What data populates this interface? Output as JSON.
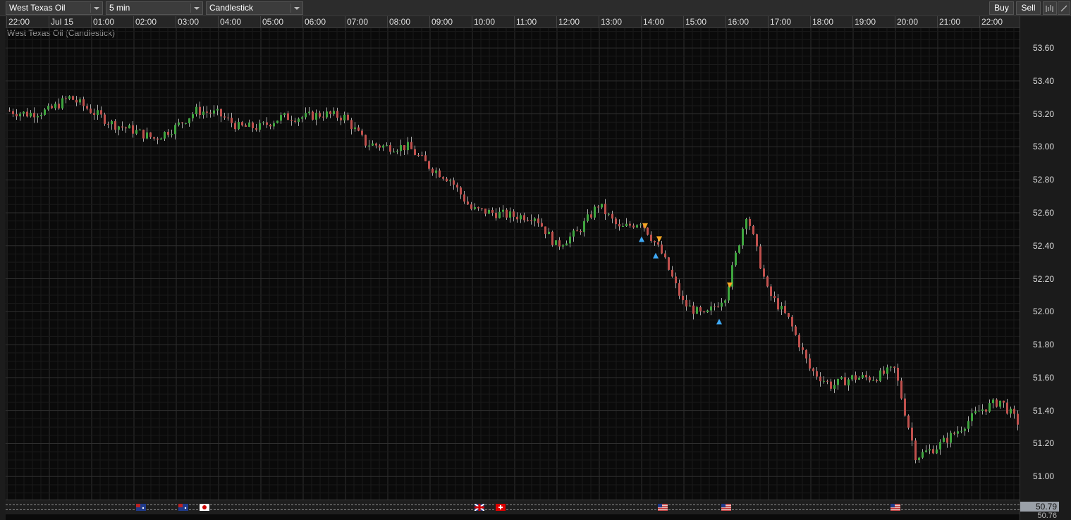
{
  "toolbar": {
    "instrument": "West Texas Oil",
    "interval": "5 min",
    "chart_type": "Candlestick",
    "buy_label": "Buy",
    "sell_label": "Sell"
  },
  "chart_title": "West Texas Oil (Candlestick)",
  "current_price": "50.79",
  "current_price_below": "50.76",
  "colors": {
    "up": "#3fa63f",
    "down": "#c0504d",
    "wick": "#aaaaaa",
    "buy_marker": "#3fa9f5",
    "sell_marker": "#f5a623"
  },
  "chart_data": {
    "type": "candlestick",
    "x_ticks": [
      "22:00",
      "Jul 15",
      "01:00",
      "02:00",
      "03:00",
      "04:00",
      "05:00",
      "06:00",
      "07:00",
      "08:00",
      "09:00",
      "10:00",
      "11:00",
      "12:00",
      "13:00",
      "14:00",
      "15:00",
      "16:00",
      "17:00",
      "18:00",
      "19:00",
      "20:00",
      "21:00",
      "22:00"
    ],
    "y_ticks": [
      "53.60",
      "53.40",
      "53.20",
      "53.00",
      "52.80",
      "52.60",
      "52.40",
      "52.20",
      "52.00",
      "51.80",
      "51.60",
      "51.40",
      "51.20",
      "51.00"
    ],
    "ylim": [
      50.86,
      53.72
    ],
    "grid": true,
    "path_points": [
      [
        "22:00",
        53.22
      ],
      [
        "22:30",
        53.2
      ],
      [
        "23:00",
        53.22
      ],
      [
        "23:30",
        53.3
      ],
      [
        "Jul 15",
        53.22
      ],
      [
        "00:30",
        53.14
      ],
      [
        "01:00",
        53.1
      ],
      [
        "01:30",
        53.05
      ],
      [
        "02:00",
        53.12
      ],
      [
        "02:30",
        53.22
      ],
      [
        "03:00",
        53.2
      ],
      [
        "03:30",
        53.12
      ],
      [
        "04:00",
        53.12
      ],
      [
        "04:30",
        53.18
      ],
      [
        "05:00",
        53.18
      ],
      [
        "05:30",
        53.2
      ],
      [
        "06:00",
        53.18
      ],
      [
        "06:30",
        53.02
      ],
      [
        "07:00",
        53.0
      ],
      [
        "07:30",
        53.0
      ],
      [
        "08:00",
        52.88
      ],
      [
        "08:30",
        52.8
      ],
      [
        "09:00",
        52.62
      ],
      [
        "09:30",
        52.6
      ],
      [
        "10:00",
        52.58
      ],
      [
        "10:30",
        52.58
      ],
      [
        "11:00",
        52.4
      ],
      [
        "11:30",
        52.48
      ],
      [
        "12:00",
        52.65
      ],
      [
        "12:30",
        52.5
      ],
      [
        "13:00",
        52.55
      ],
      [
        "13:30",
        52.35
      ],
      [
        "14:00",
        52.05
      ],
      [
        "14:30",
        51.97
      ],
      [
        "15:00",
        52.1
      ],
      [
        "15:30",
        52.6
      ],
      [
        "16:00",
        52.12
      ],
      [
        "16:30",
        51.95
      ],
      [
        "17:00",
        51.65
      ],
      [
        "17:30",
        51.55
      ],
      [
        "18:00",
        51.6
      ],
      [
        "18:30",
        51.6
      ],
      [
        "19:00",
        51.65
      ],
      [
        "19:30",
        51.12
      ],
      [
        "20:00",
        51.18
      ],
      [
        "20:30",
        51.28
      ],
      [
        "21:00",
        51.4
      ],
      [
        "21:30",
        51.46
      ],
      [
        "22:00",
        51.3
      ]
    ],
    "markers": [
      {
        "type": "sell",
        "time": "13:05",
        "price": 52.52
      },
      {
        "type": "buy",
        "time": "13:00",
        "price": 52.44
      },
      {
        "type": "sell",
        "time": "13:25",
        "price": 52.44
      },
      {
        "type": "buy",
        "time": "13:20",
        "price": 52.34
      },
      {
        "type": "buy",
        "time": "14:50",
        "price": 51.94
      },
      {
        "type": "sell",
        "time": "15:05",
        "price": 52.16
      }
    ]
  },
  "event_flags": [
    {
      "country": "AU",
      "time": "01:10"
    },
    {
      "country": "AU",
      "time": "02:10"
    },
    {
      "country": "JP",
      "time": "02:40"
    },
    {
      "country": "GB",
      "time": "09:10"
    },
    {
      "country": "CH",
      "time": "09:40"
    },
    {
      "country": "US",
      "time": "13:30"
    },
    {
      "country": "US",
      "time": "15:00"
    },
    {
      "country": "US",
      "time": "19:00"
    }
  ],
  "icons": {
    "chart_tools": "chart-tools-icon",
    "draw": "draw-line-icon"
  }
}
